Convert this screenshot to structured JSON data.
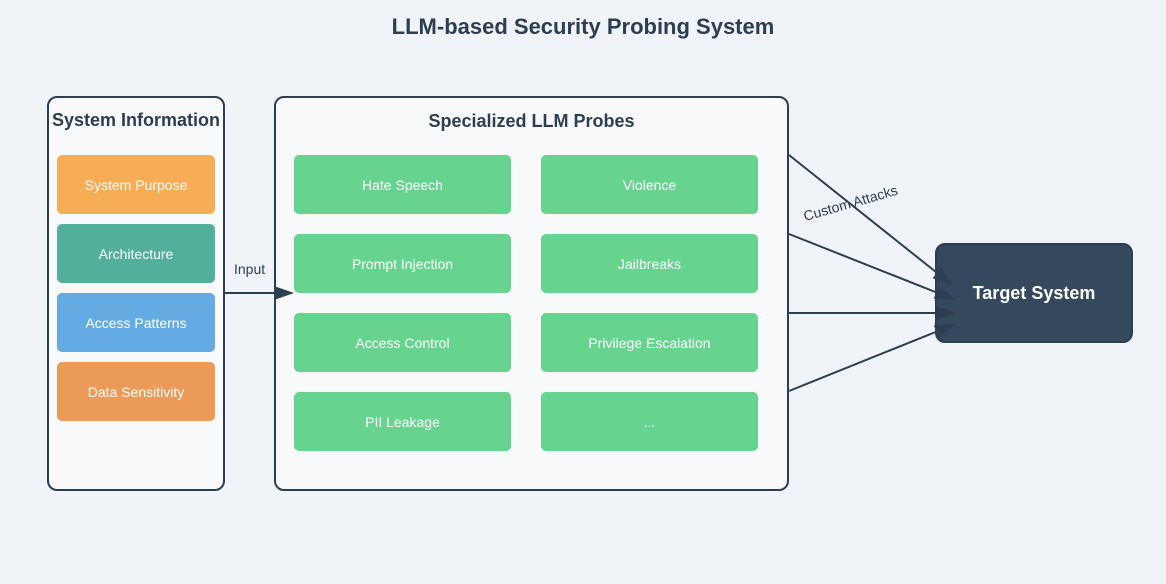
{
  "title": "LLM-based Security Probing System",
  "system_information": {
    "heading": "System Information",
    "items": [
      {
        "label": "System Purpose",
        "color": "#f6ad55"
      },
      {
        "label": "Architecture",
        "color": "#52b09a"
      },
      {
        "label": "Access Patterns",
        "color": "#63abe2"
      },
      {
        "label": "Data Sensitivity",
        "color": "#ec9a58"
      }
    ]
  },
  "probes": {
    "heading": "Specialized LLM Probes",
    "items": [
      {
        "label": "Hate Speech"
      },
      {
        "label": "Violence"
      },
      {
        "label": "Prompt Injection"
      },
      {
        "label": "Jailbreaks"
      },
      {
        "label": "Access Control"
      },
      {
        "label": "Privilege Escalation"
      },
      {
        "label": "PII Leakage"
      },
      {
        "label": "..."
      }
    ],
    "color": "#66d48f"
  },
  "edges": {
    "input_label": "Input",
    "attacks_label": "Custom Attacks"
  },
  "target": {
    "label": "Target System",
    "color": "#34495e"
  }
}
